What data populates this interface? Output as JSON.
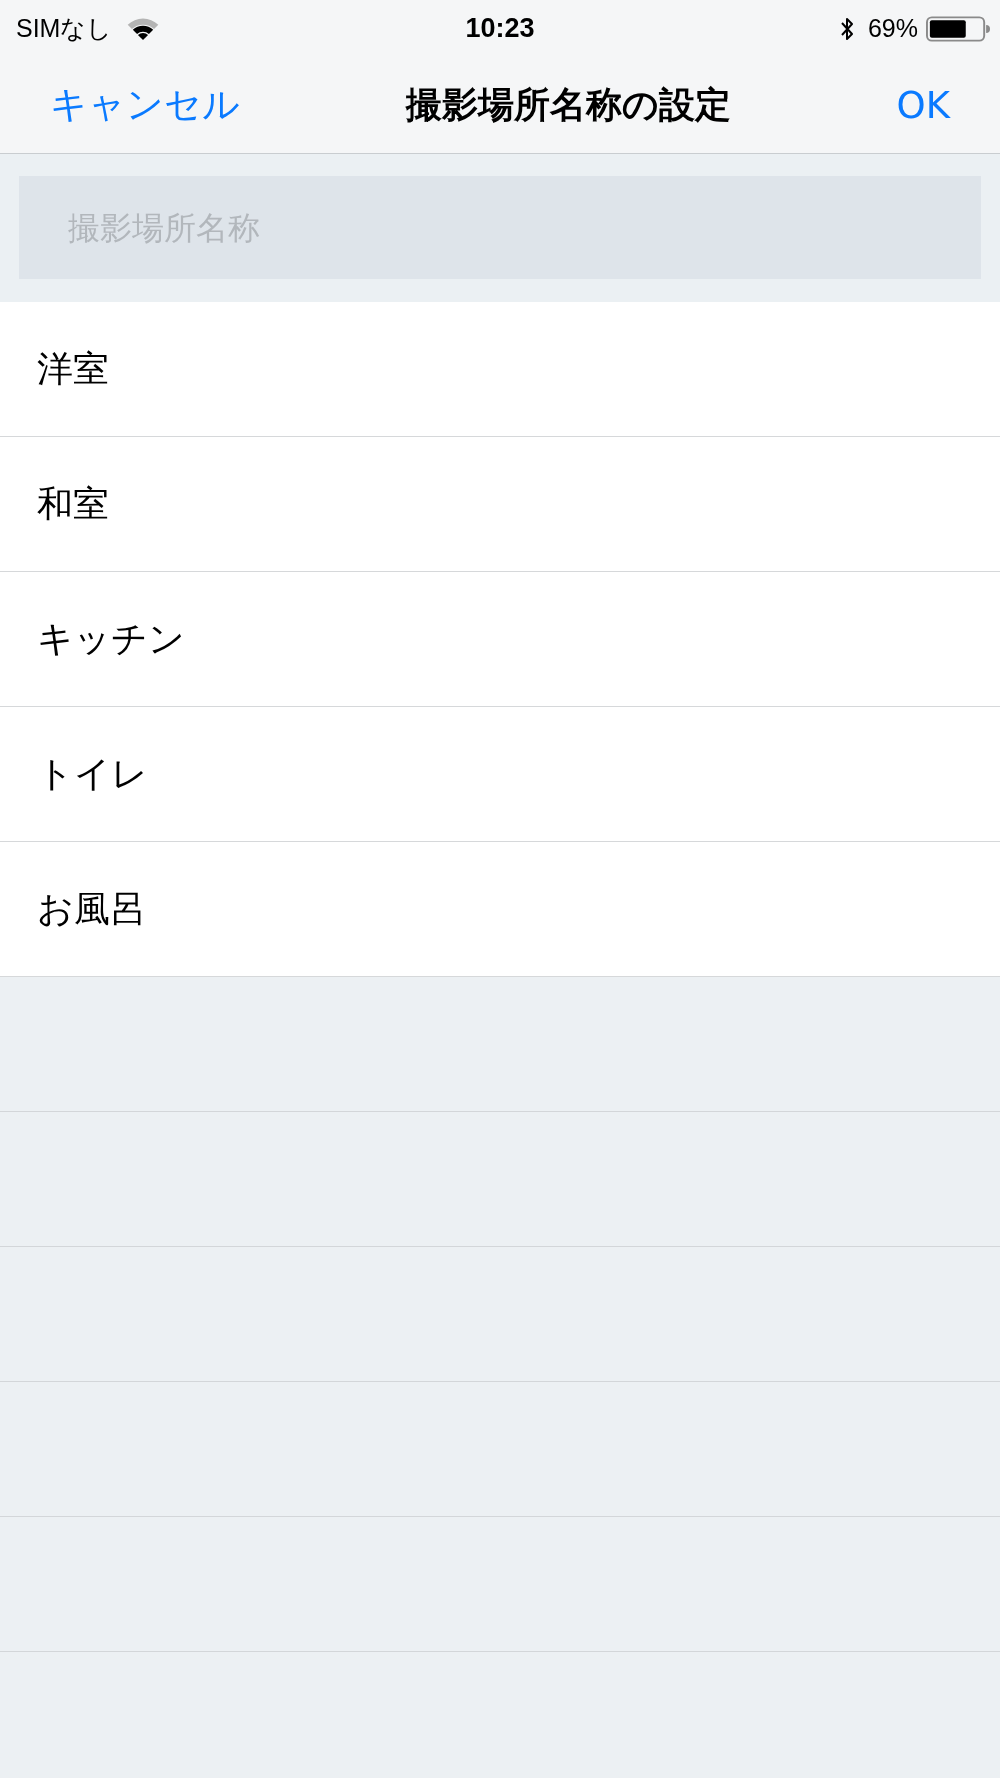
{
  "status_bar": {
    "carrier": "SIMなし",
    "time": "10:23",
    "battery_text": "69%"
  },
  "nav_bar": {
    "cancel": "キャンセル",
    "title": "撮影場所名称の設定",
    "ok": "OK"
  },
  "search": {
    "placeholder": "撮影場所名称"
  },
  "rows": [
    {
      "label": "洋室"
    },
    {
      "label": "和室"
    },
    {
      "label": "キッチン"
    },
    {
      "label": "トイレ"
    },
    {
      "label": "お風呂"
    }
  ]
}
